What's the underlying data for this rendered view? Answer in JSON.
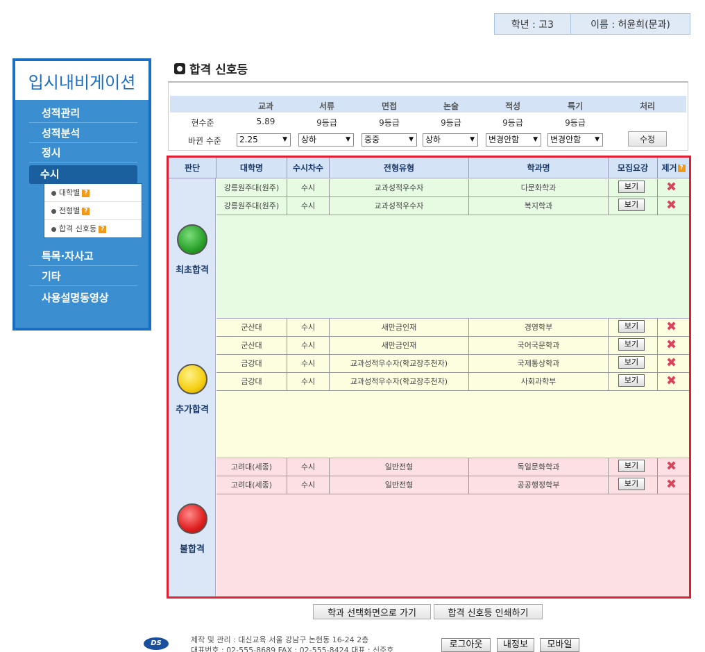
{
  "user": {
    "grade": "학년 : 고3",
    "name": "이름 : 허윤희(문과)"
  },
  "sidebar": {
    "title": "입시내비게이션",
    "items": [
      "성적관리",
      "성적분석",
      "정시",
      "수시",
      "특목·자사고",
      "기타",
      "사용설명동영상"
    ],
    "subitems": [
      "대학별",
      "전형별",
      "합격 신호등"
    ]
  },
  "page_title": "합격 신호등",
  "levels": {
    "headers": [
      "교과",
      "서류",
      "면접",
      "논술",
      "적성",
      "특기",
      "처리"
    ],
    "current_label": "현수준",
    "current": [
      "5.89",
      "9등급",
      "9등급",
      "9등급",
      "9등급",
      "9등급"
    ],
    "changed_label": "바뀐 수준",
    "changed": [
      "2.25",
      "상하",
      "중중",
      "상하",
      "변경안함",
      "변경안함"
    ],
    "edit_button": "수정"
  },
  "table": {
    "headers": [
      "판단",
      "대학명",
      "수시차수",
      "전형유형",
      "학과명",
      "모집요강",
      "제거"
    ],
    "view_label": "보기",
    "groups": [
      {
        "label": "최초합격",
        "rows": [
          {
            "univ": "강릉원주대(원주)",
            "cha": "수시",
            "type": "교과성적우수자",
            "dept": "다문화학과"
          },
          {
            "univ": "강릉원주대(원주)",
            "cha": "수시",
            "type": "교과성적우수자",
            "dept": "복지학과"
          }
        ]
      },
      {
        "label": "추가합격",
        "rows": [
          {
            "univ": "군산대",
            "cha": "수시",
            "type": "새만금인재",
            "dept": "경영학부"
          },
          {
            "univ": "군산대",
            "cha": "수시",
            "type": "새만금인재",
            "dept": "국어국문학과"
          },
          {
            "univ": "금강대",
            "cha": "수시",
            "type": "교과성적우수자(학교장추천자)",
            "dept": "국제통상학과"
          },
          {
            "univ": "금강대",
            "cha": "수시",
            "type": "교과성적우수자(학교장추천자)",
            "dept": "사회과학부"
          }
        ]
      },
      {
        "label": "불합격",
        "rows": [
          {
            "univ": "고려대(세종)",
            "cha": "수시",
            "type": "일반전형",
            "dept": "독일문화학과"
          },
          {
            "univ": "고려대(세종)",
            "cha": "수시",
            "type": "일반전형",
            "dept": "공공행정학부"
          }
        ]
      }
    ]
  },
  "bottom_buttons": {
    "back": "학과 선택화면으로 가기",
    "print": "합격 신호등 인쇄하기"
  },
  "footer": {
    "logo": "DS",
    "line1": "제작 및 관리 : 대신교육 서울 강남구 논현동 16-24 2층",
    "line2": "대표번호 : 02-555-8689   FAX : 02-555-8424   대표 : 신주호",
    "logout": "로그아웃",
    "myinfo": "내정보",
    "mobile": "모바일"
  }
}
